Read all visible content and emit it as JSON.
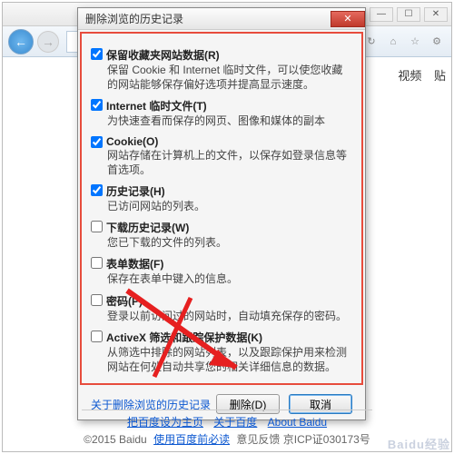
{
  "browser": {
    "nav_back": "←",
    "nav_fwd": "→",
    "min": "—",
    "max": "☐",
    "close": "✕",
    "refresh": "↻",
    "home": "⌂",
    "star": "☆",
    "gear": "⚙"
  },
  "side": {
    "video": "视频",
    "tieba": "贴"
  },
  "dialog": {
    "title": "删除浏览的历史记录",
    "close_x": "✕",
    "items": [
      {
        "checked": true,
        "label": "保留收藏夹网站数据(R)",
        "desc": "保留 Cookie 和 Internet 临时文件，可以使您收藏的网站能够保存偏好选项并提高显示速度。"
      },
      {
        "checked": true,
        "label": "Internet 临时文件(T)",
        "desc": "为快速查看而保存的网页、图像和媒体的副本"
      },
      {
        "checked": true,
        "label": "Cookie(O)",
        "desc": "网站存储在计算机上的文件，以保存如登录信息等首选项。"
      },
      {
        "checked": true,
        "label": "历史记录(H)",
        "desc": "已访问网站的列表。"
      },
      {
        "checked": false,
        "label": "下载历史记录(W)",
        "desc": "您已下载的文件的列表。"
      },
      {
        "checked": false,
        "label": "表单数据(F)",
        "desc": "保存在表单中键入的信息。"
      },
      {
        "checked": false,
        "label": "密码(P)",
        "desc": "登录以前访问过的网站时，自动填充保存的密码。"
      },
      {
        "checked": false,
        "label": "ActiveX 筛选和跟踪保护数据(K)",
        "desc": "从筛选中排除的网站列表，以及跟踪保护用来检测网站在何处自动共享您的相关详细信息的数据。"
      }
    ],
    "about_link": "关于删除浏览的历史记录",
    "delete_btn": "删除(D)",
    "cancel_btn": "取消"
  },
  "footer": {
    "set_home": "把百度设为主页",
    "about_baidu_cn": "关于百度",
    "about_baidu_en": "About Baidu",
    "copyright_pre": "©2015 Baidu ",
    "must_read": "使用百度前必读",
    "feedback": " 意见反馈 京ICP证030173号"
  },
  "watermark": "Baidu经验"
}
